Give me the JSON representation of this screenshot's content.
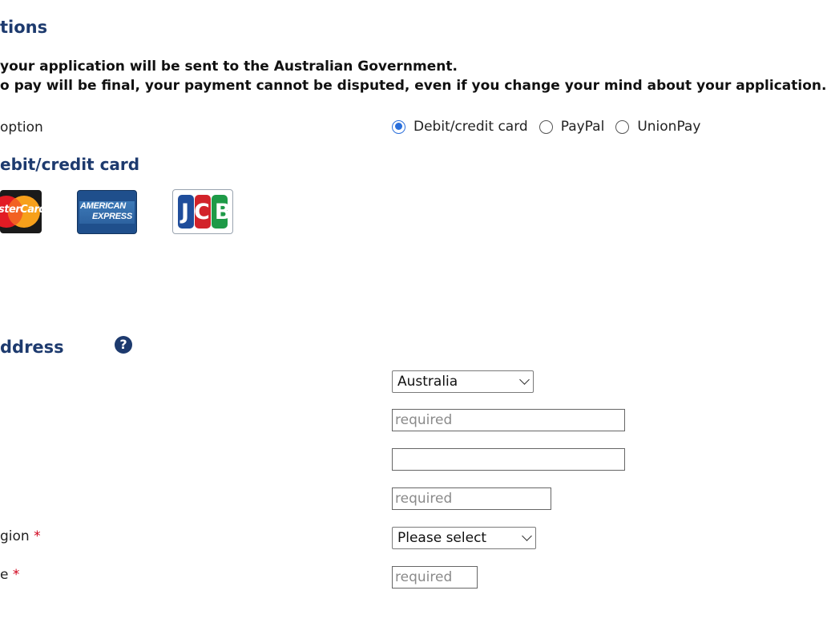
{
  "section": {
    "title": "tions",
    "notice_line1": "your application will be sent to the Australian Government.",
    "notice_line2": "o pay will be final, your payment cannot be disputed, even if you change your mind about your application."
  },
  "payment_option": {
    "label": "option",
    "options": [
      {
        "label": "Debit/credit card",
        "selected": true
      },
      {
        "label": "PayPal",
        "selected": false
      },
      {
        "label": "UnionPay",
        "selected": false
      }
    ]
  },
  "card_section": {
    "title": "ebit/credit card",
    "logos": [
      {
        "name": "mastercard",
        "text": "sterCard"
      },
      {
        "name": "american-express",
        "text_line1": "AMERICAN",
        "text_line2": "EXPRESS"
      },
      {
        "name": "jcb",
        "text": "JCB"
      }
    ]
  },
  "address": {
    "title": "ddress",
    "help_icon": "?",
    "country": {
      "value": "Australia"
    },
    "line1": {
      "placeholder": "required"
    },
    "line2": {
      "placeholder": ""
    },
    "city": {
      "placeholder": "required"
    },
    "region": {
      "label": "gion",
      "required_mark": "*",
      "value": "Please select"
    },
    "postcode": {
      "label": "e",
      "required_mark": "*",
      "placeholder": "required"
    }
  },
  "colors": {
    "heading": "#1d3a6e",
    "radio_selected": "#2a6fdb",
    "required_star": "#d0021b"
  }
}
